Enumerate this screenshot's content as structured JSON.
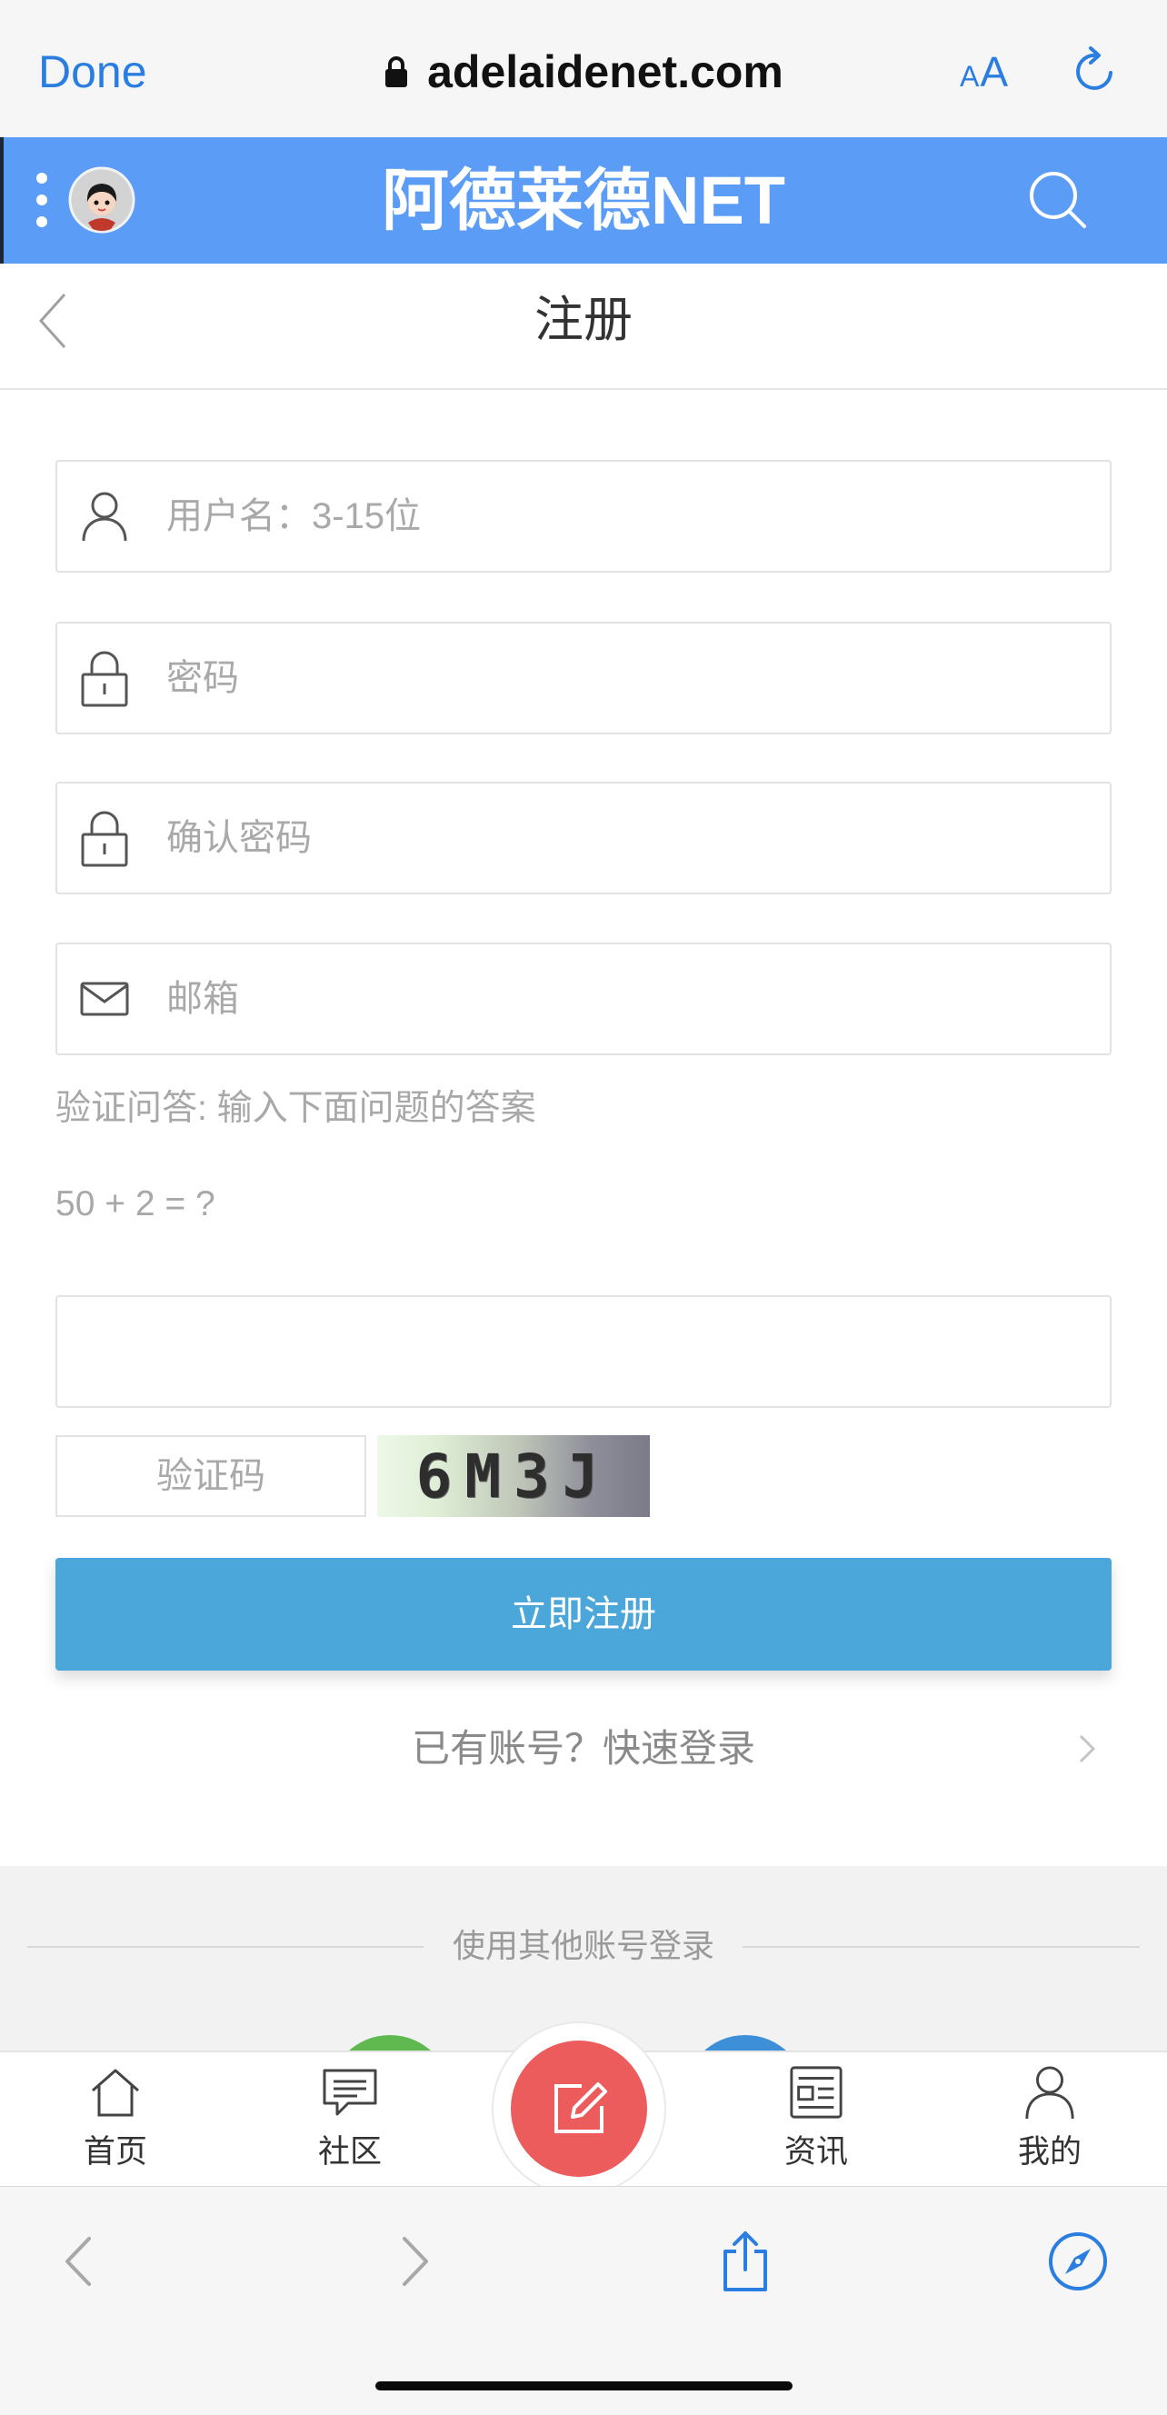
{
  "browser": {
    "done_label": "Done",
    "domain": "adelaidenet.com",
    "text_size_label": "AA",
    "lock_icon": "lock-icon",
    "reload_icon": "reload-icon"
  },
  "site_header": {
    "title": "阿德莱德NET",
    "menu_icon": "more-vertical-icon",
    "avatar_icon": "avatar",
    "search_icon": "search-icon"
  },
  "page_header": {
    "title": "注册",
    "back_icon": "chevron-left-icon"
  },
  "register_form": {
    "username": {
      "placeholder": "用户名：3-15位",
      "value": "",
      "icon": "user-icon"
    },
    "password": {
      "placeholder": "密码",
      "value": "",
      "icon": "lock-icon"
    },
    "confirm_password": {
      "placeholder": "确认密码",
      "value": "",
      "icon": "lock-icon"
    },
    "email": {
      "placeholder": "邮箱",
      "value": "",
      "icon": "mail-icon"
    },
    "qa_hint": "验证问答: 输入下面问题的答案",
    "qa_question": "50 + 2 = ?",
    "qa_answer": {
      "value": ""
    },
    "captcha": {
      "placeholder": "验证码",
      "value": "",
      "image_text": "6M3J"
    },
    "submit_label": "立即注册",
    "login_link": "已有账号？快速登录",
    "login_icon": "chevron-right-icon"
  },
  "social_login": {
    "divider_text": "使用其他账号登录"
  },
  "tab_bar": {
    "items": [
      {
        "label": "首页",
        "icon": "home-icon"
      },
      {
        "label": "社区",
        "icon": "chat-icon"
      },
      {
        "label": "资讯",
        "icon": "news-icon"
      },
      {
        "label": "我的",
        "icon": "user-icon"
      }
    ],
    "center_button_icon": "edit-icon"
  },
  "browser_toolbar": {
    "back_icon": "chevron-left-icon",
    "forward_icon": "chevron-right-icon",
    "share_icon": "share-icon",
    "compass_icon": "compass-icon"
  },
  "colors": {
    "browser_blue": "#2a7de1",
    "header_blue": "#5b9cf7",
    "button_blue": "#4ba6da",
    "compose_red": "#ec5c5c",
    "social_green": "#5fb94f",
    "social_blue": "#3d8fd8",
    "placeholder_gray": "#a9a9a9"
  }
}
